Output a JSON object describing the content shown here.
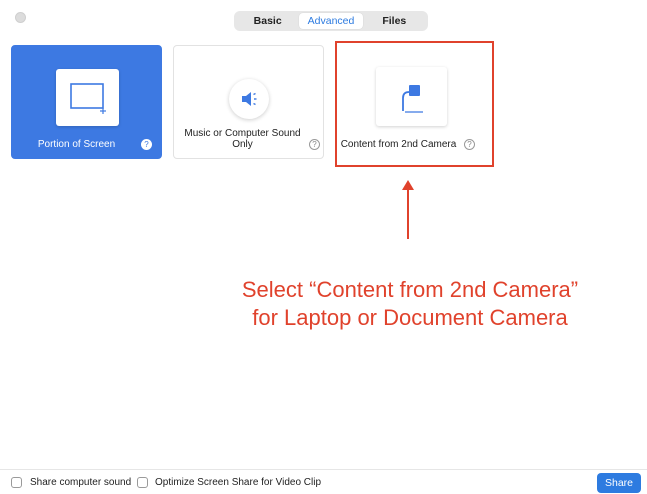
{
  "tabs": [
    {
      "label": "Basic",
      "active": false
    },
    {
      "label": "Advanced",
      "active": true
    },
    {
      "label": "Files",
      "active": false
    }
  ],
  "options": [
    {
      "label": "Portion of Screen",
      "icon": "screen-portion-icon",
      "selected": true,
      "help": "?"
    },
    {
      "label": "Music or Computer Sound Only",
      "icon": "speaker-icon",
      "selected": false,
      "help": "?"
    },
    {
      "label": "Content from 2nd Camera",
      "icon": "document-camera-icon",
      "selected": false,
      "help": "?"
    }
  ],
  "annotation": {
    "line1": "Select “Content from 2nd Camera”",
    "line2": "for Laptop or Document Camera",
    "color": "#e0422c"
  },
  "footer": {
    "share_sound_label": "Share computer sound",
    "optimize_label": "Optimize Screen Share for Video Clip",
    "share_button": "Share"
  },
  "colors": {
    "accent": "#2d7be0",
    "selected_card": "#3d79e2"
  }
}
